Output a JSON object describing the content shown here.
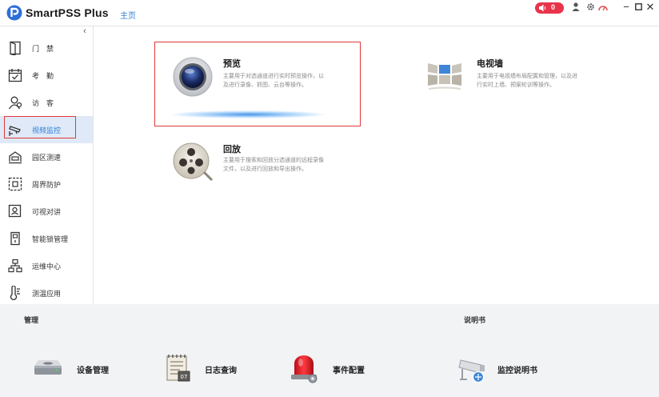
{
  "app": {
    "name": "SmartPSS Plus",
    "home_tab": "主页"
  },
  "titlebar": {
    "alarm_count": "0"
  },
  "sidebar": {
    "items": [
      {
        "label": "门　禁"
      },
      {
        "label": "考　勤"
      },
      {
        "label": "访　客"
      },
      {
        "label": "视频监控"
      },
      {
        "label": "园区测速"
      },
      {
        "label": "周界防护"
      },
      {
        "label": "可视对讲"
      },
      {
        "label": "智能锁管理"
      },
      {
        "label": "运维中心"
      },
      {
        "label": "测温应用"
      }
    ],
    "active_index": 3
  },
  "main": {
    "cards": [
      {
        "name": "预览",
        "desc_line1": "主要用于对选通道进行实时预览操作，以",
        "desc_line2": "及进行录像、抓图、云台等操作。"
      },
      {
        "name": "电视墙",
        "desc_line1": "主要用于电视墙布局配置和管理，以及进",
        "desc_line2": "行实时上墙、预案轮训等操作。"
      },
      {
        "name": "回放",
        "desc_line1": "主要用于搜索和回放分选通道的远程录像",
        "desc_line2": "文件，以及进行回放和导出操作。"
      }
    ]
  },
  "bottom": {
    "manage_title": "管理",
    "manual_title": "说明书",
    "tools": [
      {
        "label": "设备管理"
      },
      {
        "label": "日志查询"
      },
      {
        "label": "事件配置"
      },
      {
        "label": "监控说明书"
      }
    ]
  },
  "colors": {
    "accent": "#2d7fd7",
    "highlight_frame": "#e03a3a",
    "alarm": "#e8334a",
    "active_bg": "#dfe9f7"
  }
}
